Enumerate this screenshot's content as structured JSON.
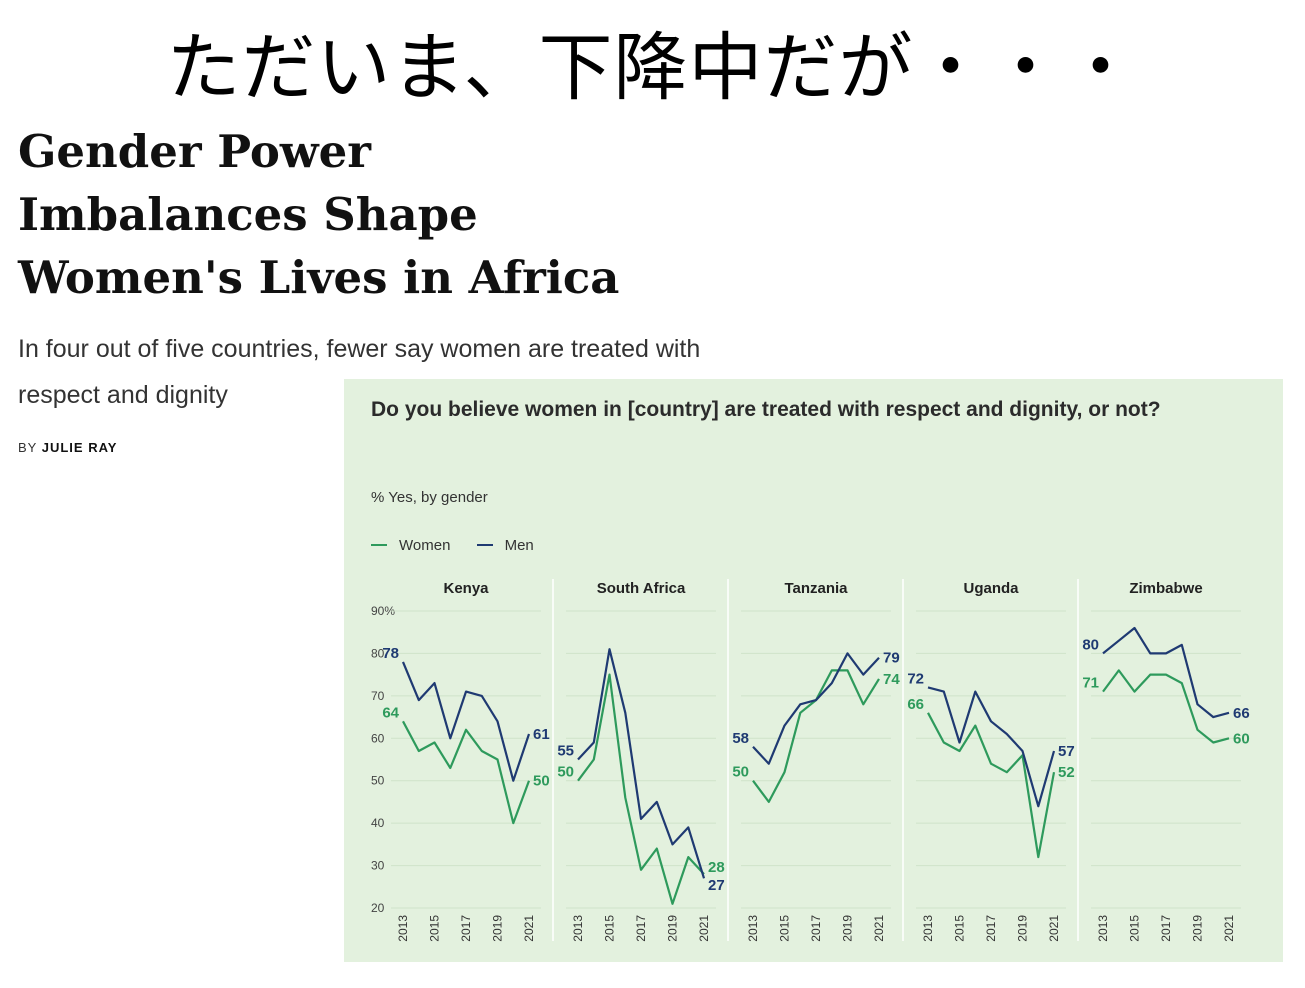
{
  "banner": "ただいま、下降中だが・・・",
  "article": {
    "headline": "Gender Power Imbalances Shape Women's Lives in Africa",
    "subheadline": "In four out of five countries, fewer say women are treated with respect and dignity",
    "byline_prefix": "BY",
    "author": "JULIE RAY"
  },
  "colors": {
    "women": "#2e9a5c",
    "men": "#1f3a72",
    "panel_bg": "#e3f1de"
  },
  "chart_data": {
    "type": "line",
    "title": "Do you believe women in [country] are treated with respect and dignity, or not?",
    "subtitle": "% Yes, by gender",
    "legend": [
      "Women",
      "Men"
    ],
    "ylim": [
      20,
      90
    ],
    "yticks": [
      "90%",
      "80",
      "70",
      "60",
      "50",
      "40",
      "30",
      "20"
    ],
    "x": [
      2013,
      2014,
      2015,
      2016,
      2017,
      2018,
      2019,
      2020,
      2021
    ],
    "xtick_labels": [
      "2013",
      "2015",
      "2017",
      "2019",
      "2021"
    ],
    "panels": [
      {
        "country": "Kenya",
        "series": [
          {
            "name": "Women",
            "values": [
              64,
              57,
              59,
              53,
              62,
              57,
              55,
              40,
              50
            ]
          },
          {
            "name": "Men",
            "values": [
              78,
              69,
              73,
              60,
              71,
              70,
              64,
              50,
              61
            ]
          }
        ],
        "start_labels": {
          "Women": "64",
          "Men": "78"
        },
        "end_labels": {
          "Women": "50",
          "Men": "61"
        }
      },
      {
        "country": "South Africa",
        "series": [
          {
            "name": "Women",
            "values": [
              50,
              55,
              75,
              46,
              29,
              34,
              21,
              32,
              28
            ]
          },
          {
            "name": "Men",
            "values": [
              55,
              59,
              81,
              66,
              41,
              45,
              35,
              39,
              27
            ]
          }
        ],
        "start_labels": {
          "Women": "50",
          "Men": "55"
        },
        "end_labels": {
          "Women": "28",
          "Men": "27"
        }
      },
      {
        "country": "Tanzania",
        "series": [
          {
            "name": "Women",
            "values": [
              50,
              45,
              52,
              66,
              69,
              76,
              76,
              68,
              74
            ]
          },
          {
            "name": "Men",
            "values": [
              58,
              54,
              63,
              68,
              69,
              73,
              80,
              75,
              79
            ]
          }
        ],
        "start_labels": {
          "Women": "50",
          "Men": "58"
        },
        "end_labels": {
          "Women": "74",
          "Men": "79"
        }
      },
      {
        "country": "Uganda",
        "series": [
          {
            "name": "Women",
            "values": [
              66,
              59,
              57,
              63,
              54,
              52,
              56,
              32,
              52
            ]
          },
          {
            "name": "Men",
            "values": [
              72,
              71,
              59,
              71,
              64,
              61,
              57,
              44,
              57
            ]
          }
        ],
        "start_labels": {
          "Women": "66",
          "Men": "72"
        },
        "end_labels": {
          "Women": "52",
          "Men": "57"
        }
      },
      {
        "country": "Zimbabwe",
        "series": [
          {
            "name": "Women",
            "values": [
              71,
              76,
              71,
              75,
              75,
              73,
              62,
              59,
              60
            ]
          },
          {
            "name": "Men",
            "values": [
              80,
              83,
              86,
              80,
              80,
              82,
              68,
              65,
              66
            ]
          }
        ],
        "start_labels": {
          "Women": "71",
          "Men": "80"
        },
        "end_labels": {
          "Women": "60",
          "Men": "66"
        }
      }
    ]
  }
}
